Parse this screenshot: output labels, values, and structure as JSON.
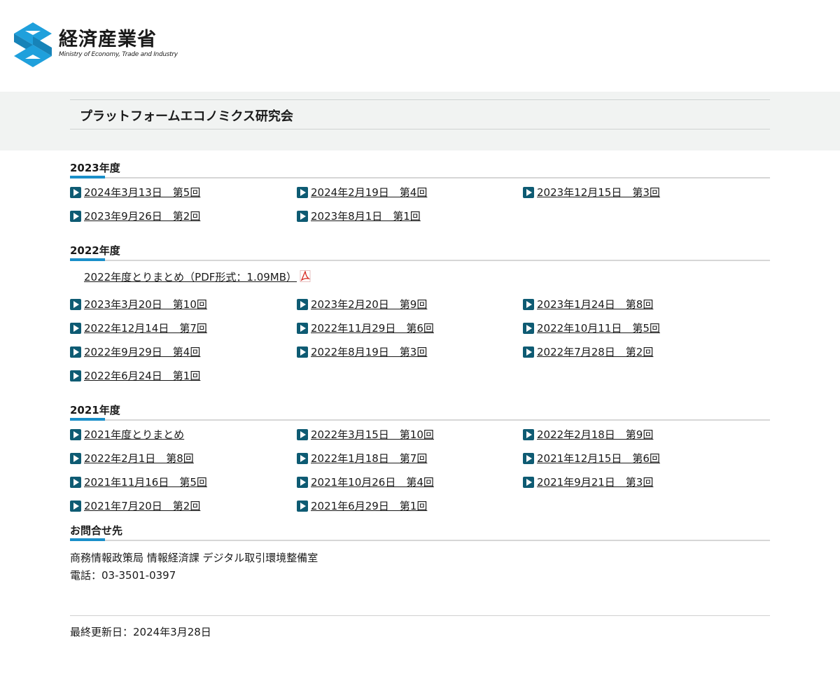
{
  "header": {
    "logo_jp": "経済産業省",
    "logo_en": "Ministry of Economy, Trade and Industry"
  },
  "page": {
    "title": "プラットフォームエコノミクス研究会"
  },
  "colors": {
    "accent": "#1a8fc9",
    "play_icon": "#0e5b73",
    "logo_blue": "#1fa0dc",
    "title_band": "#f1f3f2"
  },
  "sections": {
    "y2023": {
      "heading": "2023年度",
      "links": [
        {
          "label": "2024年3月13日　第5回"
        },
        {
          "label": "2024年2月19日　第4回"
        },
        {
          "label": "2023年12月15日　第3回"
        },
        {
          "label": "2023年9月26日　第2回"
        },
        {
          "label": "2023年8月1日　第1回"
        }
      ]
    },
    "y2022": {
      "heading": "2022年度",
      "summary": "2022年度とりまとめ（PDF形式：1.09MB）",
      "summary_icon": "pdf-icon",
      "links": [
        {
          "label": "2023年3月20日　第10回"
        },
        {
          "label": "2023年2月20日　第9回"
        },
        {
          "label": "2023年1月24日　第8回"
        },
        {
          "label": "2022年12月14日　第7回"
        },
        {
          "label": "2022年11月29日　第6回"
        },
        {
          "label": "2022年10月11日　第5回"
        },
        {
          "label": "2022年9月29日　第4回"
        },
        {
          "label": "2022年8月19日　第3回"
        },
        {
          "label": "2022年7月28日　第2回"
        },
        {
          "label": "2022年6月24日　第1回"
        }
      ]
    },
    "y2021": {
      "heading": "2021年度",
      "links": [
        {
          "label": "2021年度とりまとめ"
        },
        {
          "label": "2022年3月15日　第10回"
        },
        {
          "label": "2022年2月18日　第9回"
        },
        {
          "label": "2022年2月1日　第8回"
        },
        {
          "label": "2022年1月18日　第7回"
        },
        {
          "label": "2021年12月15日　第6回"
        },
        {
          "label": "2021年11月16日　第5回"
        },
        {
          "label": "2021年10月26日　第4回"
        },
        {
          "label": "2021年9月21日　第3回"
        },
        {
          "label": "2021年7月20日　第2回"
        },
        {
          "label": "2021年6月29日　第1回"
        }
      ]
    }
  },
  "contact": {
    "heading": "お問合せ先",
    "department": "商務情報政策局 情報経済課 デジタル取引環境整備室",
    "phone": "電話：03-3501-0397"
  },
  "footer": {
    "last_updated": "最終更新日：2024年3月28日"
  }
}
